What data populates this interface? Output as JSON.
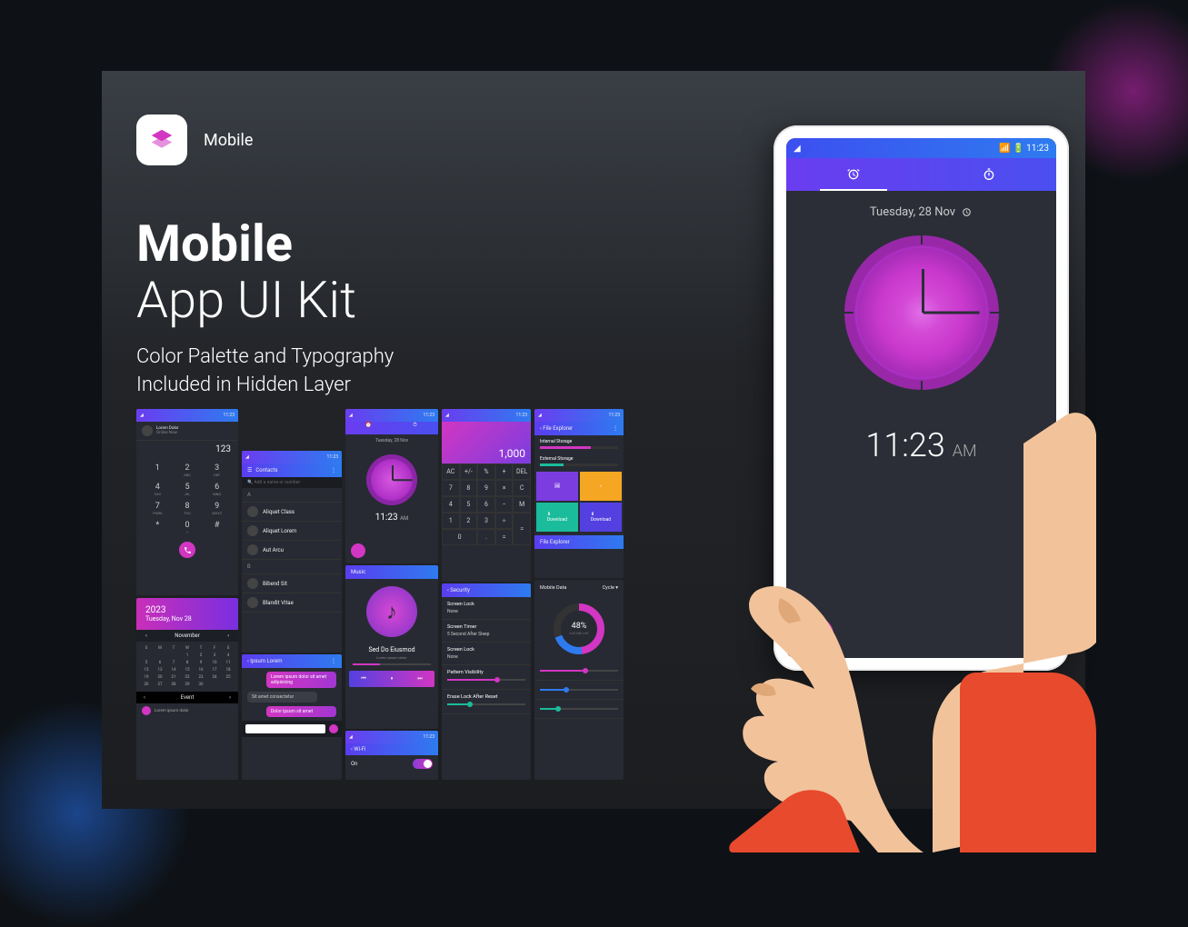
{
  "brand_label": "Mobile",
  "headline_l1": "Mobile",
  "headline_l2": "App UI Kit",
  "subhead_l1": "Color Palette and Typography",
  "subhead_l2": "Included in Hidden Layer",
  "status_time": "11:23",
  "clock_date": "Tuesday, 28 Nov",
  "clock_time": "11:23",
  "clock_ampm": "AM",
  "dialer": {
    "display": "123",
    "keys": [
      {
        "n": "1",
        "t": ""
      },
      {
        "n": "2",
        "t": "ABC"
      },
      {
        "n": "3",
        "t": "DEF"
      },
      {
        "n": "4",
        "t": "GHI"
      },
      {
        "n": "5",
        "t": "JKL"
      },
      {
        "n": "6",
        "t": "MNO"
      },
      {
        "n": "7",
        "t": "PQRS"
      },
      {
        "n": "8",
        "t": "TUV"
      },
      {
        "n": "9",
        "t": "WXYZ"
      },
      {
        "n": "*",
        "t": ""
      },
      {
        "n": "0",
        "t": "+"
      },
      {
        "n": "#",
        "t": ""
      }
    ]
  },
  "calendar": {
    "year": "2023",
    "date": "Tuesday, Nov 28",
    "month": "November",
    "days": [
      "Sun",
      "Mon",
      "Tue",
      "Wed",
      "Thu",
      "Fri",
      "Sat"
    ],
    "event_label": "Event"
  },
  "contacts_title": "Contacts",
  "chat_title": "Ipsum Lorem",
  "clock_mini": {
    "date": "Tuesday, 28 Nov",
    "time": "11:23",
    "ampm": "AM"
  },
  "music": {
    "header": "Music",
    "title": "Sed Do Eiusmod"
  },
  "wifi_label": "Wi-Fi",
  "wifi_on": "On",
  "calc_display": "1,000",
  "calc_keys": [
    "AC",
    "+/-",
    "%",
    "÷",
    "DEL",
    "7",
    "8",
    "9",
    "×",
    "C",
    "4",
    "5",
    "6",
    "−",
    "M",
    "1",
    "2",
    "3",
    "+",
    "=",
    "0",
    ".",
    "="
  ],
  "security": {
    "header": "Security",
    "r1": "Screen Lock",
    "r2": "Screen Timer",
    "r3": "Screen Lock",
    "r4": "Pattern Visibility",
    "r5": "Erase Lock After Reset"
  },
  "explorer": {
    "header": "File Explorer",
    "internal": "Internal Storage",
    "external": "External Storage",
    "tiles": [
      "Images",
      "Music",
      "Download",
      "Download"
    ],
    "bottom": "File Explorer"
  },
  "data": {
    "mobile_data": "Mobile Data",
    "cycle": "Cycle",
    "pct": "48%",
    "left": "640 MB Left"
  },
  "colors": {
    "pink": "#d236c2",
    "purple": "#7b3de0",
    "blue": "#2e7bf0",
    "orange": "#f5a623",
    "teal": "#1bbc9b"
  }
}
